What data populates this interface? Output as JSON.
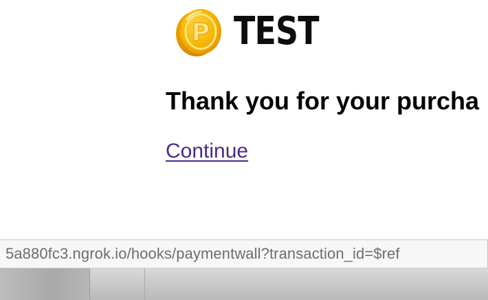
{
  "logo": {
    "icon": "p-coin-icon",
    "text": "TEST",
    "coin_color": "#f5a300"
  },
  "main": {
    "heading": "Thank you for your purcha",
    "link_label": "Continue"
  },
  "status_bar": {
    "url": "5a880fc3.ngrok.io/hooks/paymentwall?transaction_id=$ref"
  },
  "colors": {
    "link": "#4a2a8a",
    "text": "#000000",
    "status_text": "#6d6d6d"
  }
}
